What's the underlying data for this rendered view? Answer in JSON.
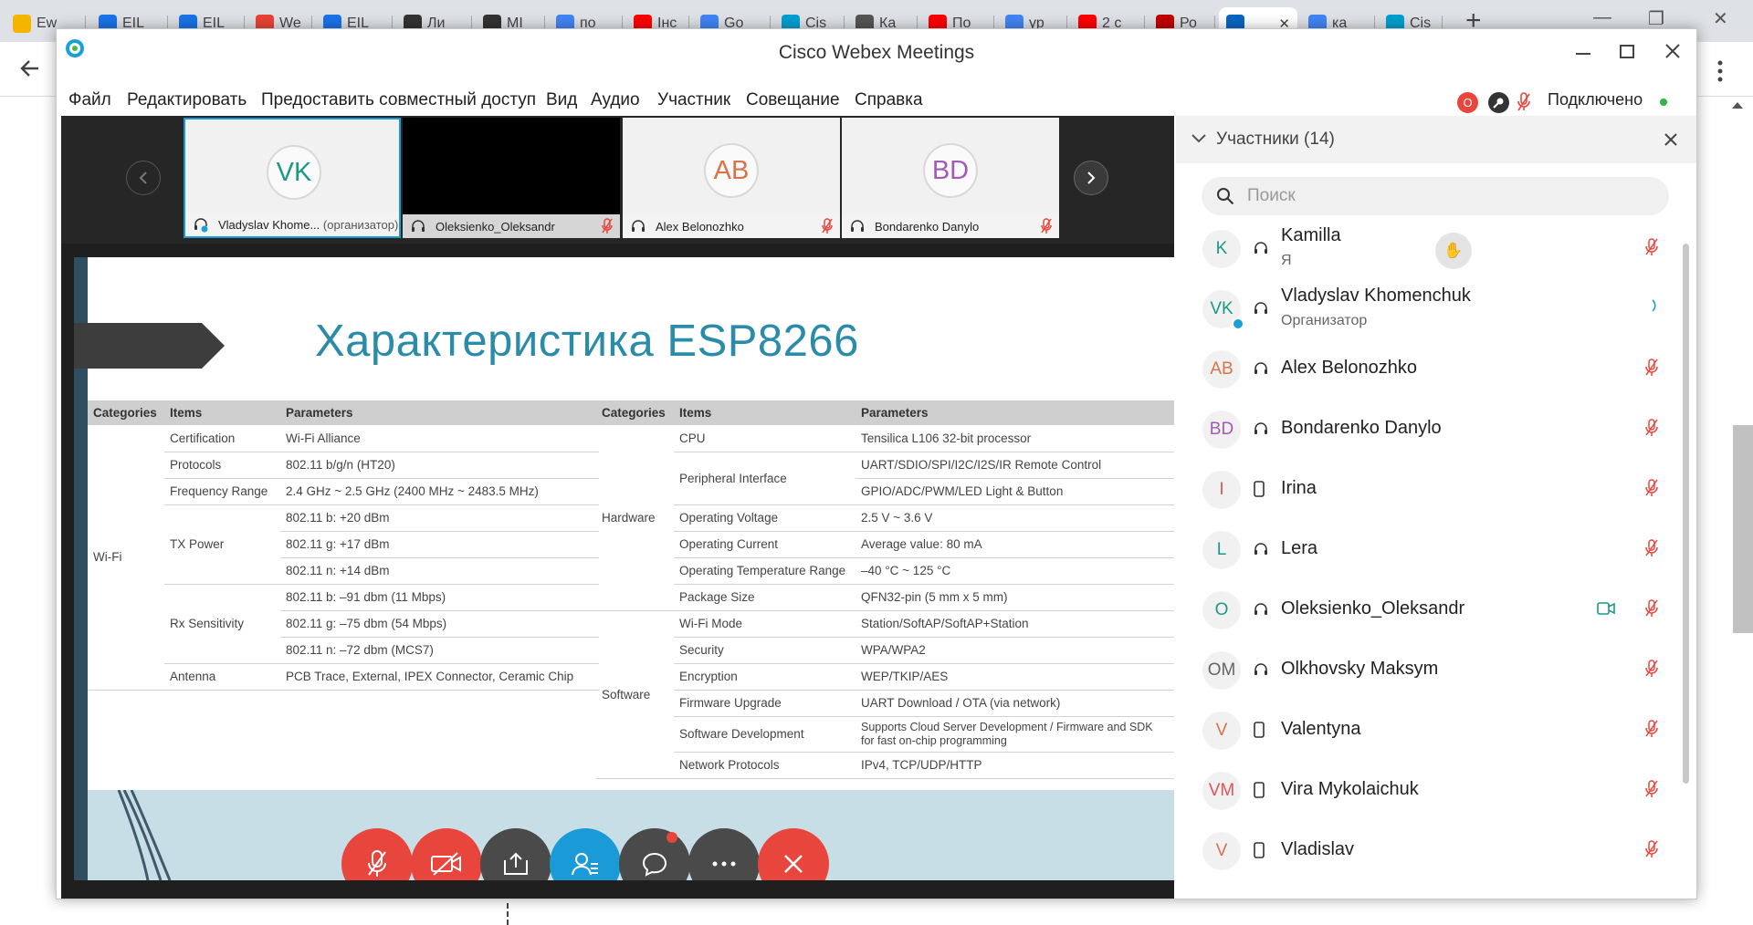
{
  "browser": {
    "tabs": [
      {
        "label": "Ew",
        "color": "#f4b400"
      },
      {
        "label": "EIL",
        "color": "#1a73e8"
      },
      {
        "label": "EIL",
        "color": "#1a73e8"
      },
      {
        "label": "We",
        "color": "#e94335"
      },
      {
        "label": "EIL",
        "color": "#1a73e8"
      },
      {
        "label": "Ли",
        "color": "#333333"
      },
      {
        "label": "MI",
        "color": "#333333"
      },
      {
        "label": "по",
        "color": "#4285f4"
      },
      {
        "label": "Інс",
        "color": "#ff0000"
      },
      {
        "label": "Go",
        "color": "#4285f4"
      },
      {
        "label": "Cis",
        "color": "#00a0d1"
      },
      {
        "label": "Ка",
        "color": "#555555"
      },
      {
        "label": "По",
        "color": "#ff0000"
      },
      {
        "label": "ур",
        "color": "#4285f4"
      },
      {
        "label": "2 с",
        "color": "#ff0000"
      },
      {
        "label": "Ро",
        "color": "#c00000"
      },
      {
        "label": "",
        "color": "#0a66c2"
      },
      {
        "label": "ка",
        "color": "#4285f4"
      },
      {
        "label": "Cis",
        "color": "#00a0d1"
      }
    ],
    "new_tab": "+"
  },
  "window": {
    "title": "Cisco Webex Meetings",
    "menu": [
      "Файл",
      "Редактировать",
      "Предоставить совместный доступ",
      "Вид",
      "Аудио",
      "Участник",
      "Совещание",
      "Справка"
    ],
    "record_badge": "O",
    "status": "Подключено",
    "status_color": "#2fb54a"
  },
  "thumbnails": [
    {
      "initials": "VK",
      "name": "Vladyslav Khome...",
      "role": "(организатор)",
      "initials_color": "#1a9a86",
      "selected": true
    },
    {
      "initials": "",
      "name": "Oleksienko_Oleksandr",
      "role": "",
      "initials_color": "#000000"
    },
    {
      "initials": "AB",
      "name": "Alex Belonozhko",
      "role": "",
      "initials_color": "#d9734a"
    },
    {
      "initials": "BD",
      "name": "Bondarenko Danylo",
      "role": "",
      "initials_color": "#a15bb7"
    }
  ],
  "slide": {
    "title": "Характеристика ESP8266",
    "left_table": {
      "headers": [
        "Categories",
        "Items",
        "Parameters"
      ],
      "category": "Wi-Fi",
      "rows": [
        {
          "item": "Certification",
          "param": "Wi-Fi Alliance"
        },
        {
          "item": "Protocols",
          "param": "802.11 b/g/n (HT20)"
        },
        {
          "item": "Frequency Range",
          "param": "2.4 GHz ~ 2.5 GHz (2400 MHz ~ 2483.5 MHz)"
        },
        {
          "item": "",
          "param": "802.11 b: +20 dBm"
        },
        {
          "item": "TX Power",
          "param": "802.11 g: +17 dBm"
        },
        {
          "item": "",
          "param": "802.11 n: +14 dBm"
        },
        {
          "item": "",
          "param": "802.11 b: –91 dbm (11 Mbps)"
        },
        {
          "item": "Rx Sensitivity",
          "param": "802.11 g: –75 dbm (54 Mbps)"
        },
        {
          "item": "",
          "param": "802.11 n: –72 dbm (MCS7)"
        },
        {
          "item": "Antenna",
          "param": "PCB Trace, External, IPEX Connector, Ceramic Chip"
        }
      ]
    },
    "right_table": {
      "headers": [
        "Categories",
        "Items",
        "Parameters"
      ],
      "cat_hardware": "Hardware",
      "cat_software": "Software",
      "rows": [
        {
          "item": "CPU",
          "param": "Tensilica L106 32-bit processor"
        },
        {
          "item": "Peripheral Interface",
          "param": "UART/SDIO/SPI/I2C/I2S/IR Remote Control"
        },
        {
          "item": "",
          "param": "GPIO/ADC/PWM/LED Light & Button"
        },
        {
          "item": "Operating Voltage",
          "param": "2.5 V ~ 3.6 V"
        },
        {
          "item": "Operating Current",
          "param": "Average value: 80 mA"
        },
        {
          "item": "Operating Temperature Range",
          "param": "–40 °C ~ 125 °C"
        },
        {
          "item": "Package Size",
          "param": "QFN32-pin (5 mm x 5 mm)"
        },
        {
          "item": "Wi-Fi Mode",
          "param": "Station/SoftAP/SoftAP+Station"
        },
        {
          "item": "Security",
          "param": "WPA/WPA2"
        },
        {
          "item": "Encryption",
          "param": "WEP/TKIP/AES"
        },
        {
          "item": "Firmware Upgrade",
          "param": "UART Download / OTA (via network)"
        },
        {
          "item": "Software Development",
          "param": "Supports Cloud Server Development / Firmware and SDK for fast on-chip programming"
        },
        {
          "item": "Network Protocols",
          "param": "IPv4, TCP/UDP/HTTP"
        }
      ]
    }
  },
  "participants": {
    "header": "Участники (14)",
    "search_placeholder": "Поиск",
    "list": [
      {
        "initials": "K",
        "name": "Kamilla",
        "role": "Я",
        "device": "headset",
        "color": "#1a9a86",
        "hand": true
      },
      {
        "initials": "VK",
        "name": "Vladyslav Khomenchuk",
        "role": "Организатор",
        "device": "headset",
        "color": "#1a9a86"
      },
      {
        "initials": "AB",
        "name": "Alex Belonozhko",
        "role": "",
        "device": "headset",
        "color": "#d9734a"
      },
      {
        "initials": "BD",
        "name": "Bondarenko Danylo",
        "role": "",
        "device": "headset",
        "color": "#a15bb7"
      },
      {
        "initials": "I",
        "name": "Irina",
        "role": "",
        "device": "phone",
        "color": "#e0545a"
      },
      {
        "initials": "L",
        "name": "Lera",
        "role": "",
        "device": "headset",
        "color": "#1a9a86"
      },
      {
        "initials": "O",
        "name": "Oleksienko_Oleksandr",
        "role": "",
        "device": "headset",
        "color": "#1a9a86",
        "video": true
      },
      {
        "initials": "OM",
        "name": "Olkhovsky Maksym",
        "role": "",
        "device": "headset",
        "color": "#666666"
      },
      {
        "initials": "V",
        "name": "Valentyna",
        "role": "",
        "device": "phone",
        "color": "#d9734a"
      },
      {
        "initials": "VM",
        "name": "Vira Mykolaichuk",
        "role": "",
        "device": "phone",
        "color": "#e0545a"
      },
      {
        "initials": "V",
        "name": "Vladislav",
        "role": "",
        "device": "phone",
        "color": "#d9734a"
      }
    ]
  },
  "controls": [
    {
      "name": "mute-button",
      "icon": "mic-off-icon",
      "color": "#e8453c"
    },
    {
      "name": "stop-video-button",
      "icon": "video-off-icon",
      "color": "#e8453c"
    },
    {
      "name": "share-button",
      "icon": "share-icon",
      "color": "#4a4a4a"
    },
    {
      "name": "participants-button",
      "icon": "participants-icon",
      "color": "#1a9ad6"
    },
    {
      "name": "chat-button",
      "icon": "chat-icon",
      "color": "#4a4a4a"
    },
    {
      "name": "more-button",
      "icon": "more-icon",
      "color": "#4a4a4a"
    },
    {
      "name": "leave-button",
      "icon": "close-icon",
      "color": "#e8453c"
    }
  ]
}
